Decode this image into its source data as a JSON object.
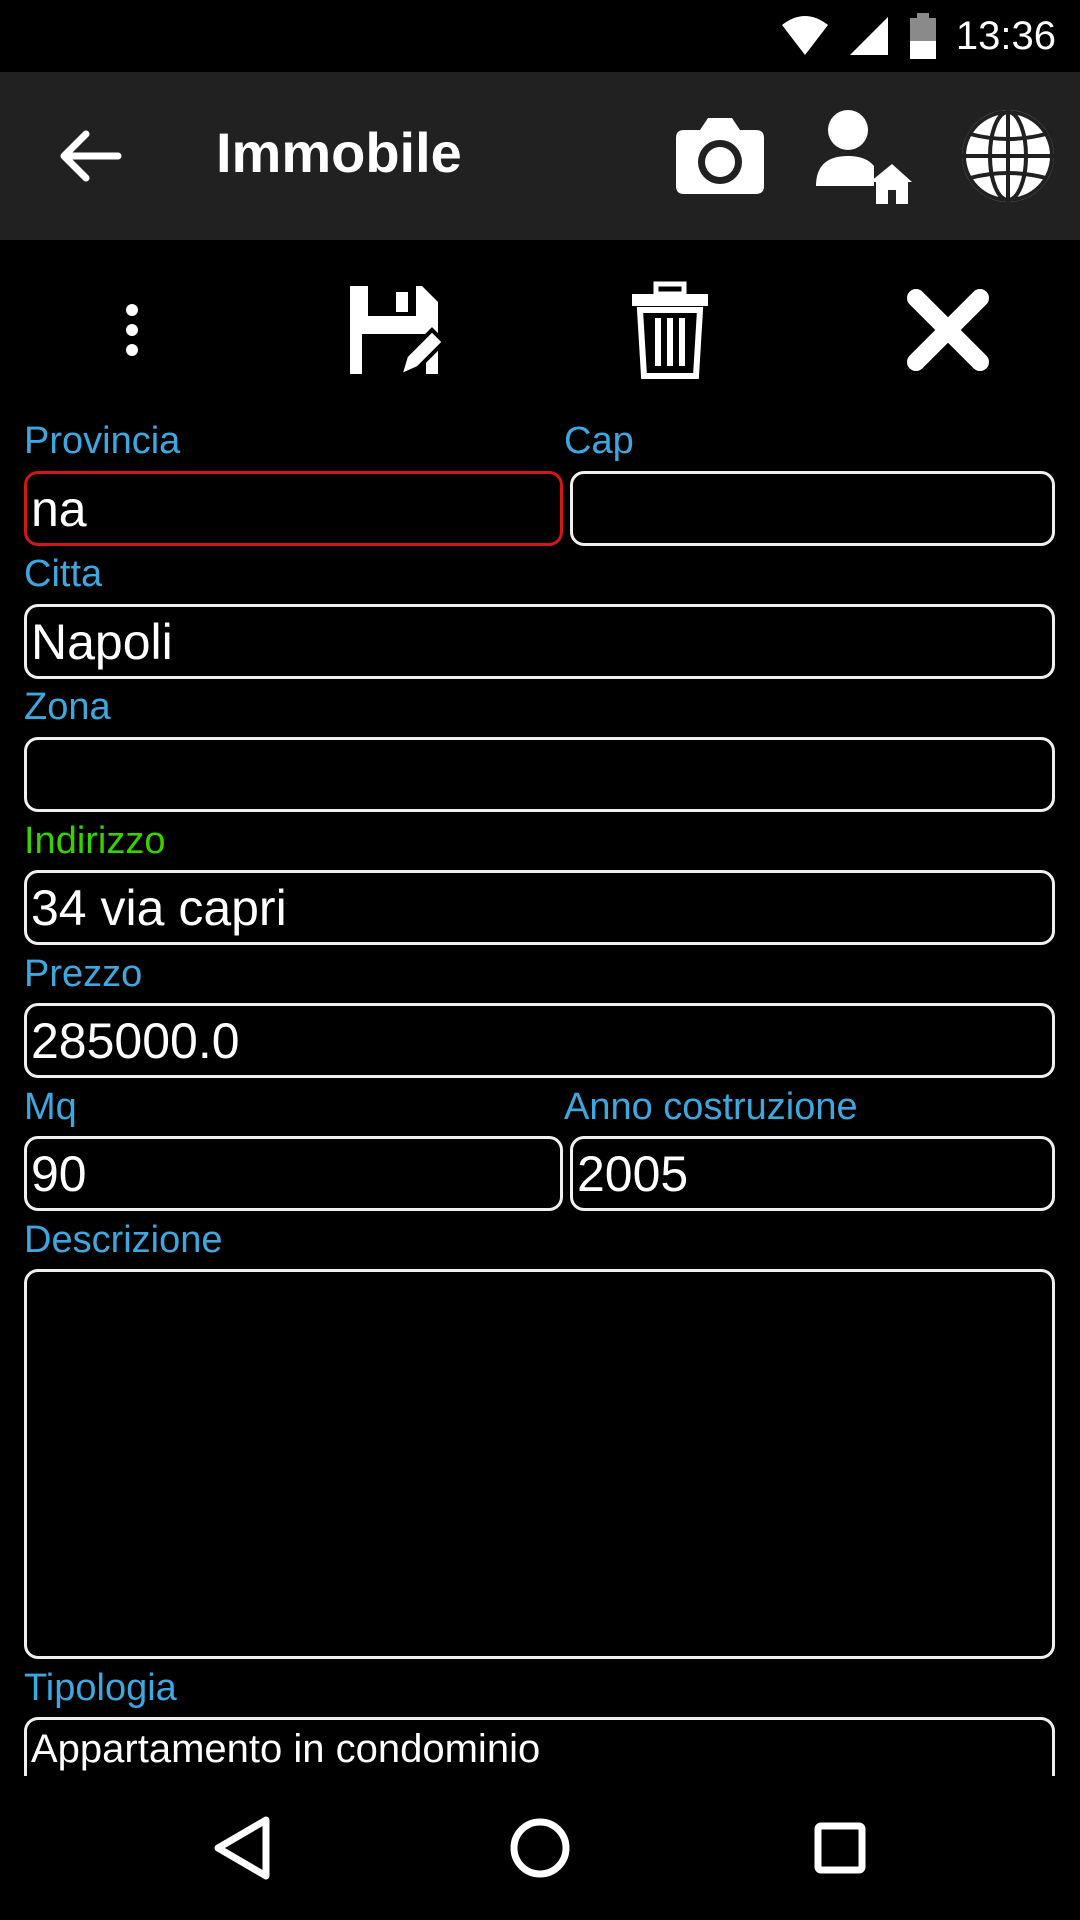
{
  "status": {
    "time": "13:36"
  },
  "app_bar": {
    "title": "Immobile"
  },
  "form": {
    "provincia": {
      "label": "Provincia",
      "value": "na"
    },
    "cap": {
      "label": "Cap",
      "value": ""
    },
    "citta": {
      "label": "Citta",
      "value": "Napoli"
    },
    "zona": {
      "label": "Zona",
      "value": ""
    },
    "indirizzo": {
      "label": "Indirizzo",
      "value": "34 via capri"
    },
    "prezzo": {
      "label": "Prezzo",
      "value": "285000.0"
    },
    "mq": {
      "label": "Mq",
      "value": "90"
    },
    "anno": {
      "label": "Anno costruzione",
      "value": "2005"
    },
    "descrizione": {
      "label": "Descrizione",
      "value": ""
    },
    "tipologia": {
      "label": "Tipologia",
      "value": "Appartamento in condominio"
    }
  },
  "colors": {
    "label": "#3da7e0",
    "label_focus": "#35d200",
    "error_border": "#d01818",
    "app_bar_bg": "#212121"
  }
}
